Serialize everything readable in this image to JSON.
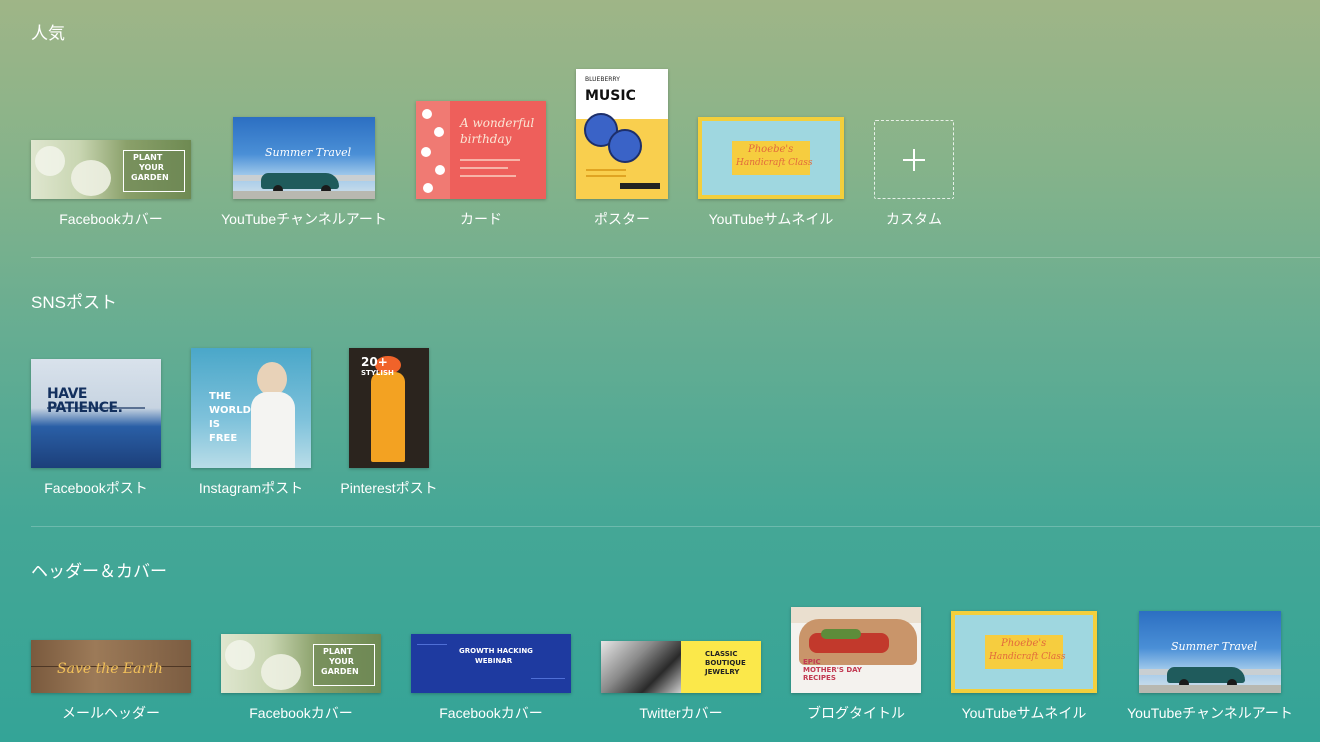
{
  "sections": [
    {
      "title": "人気"
    },
    {
      "title": "SNSポスト"
    },
    {
      "title": "ヘッダー＆カバー"
    }
  ],
  "popular": [
    {
      "label": "Facebookカバー",
      "thumb_text": [
        "PLANT",
        "YOUR",
        "GARDEN"
      ]
    },
    {
      "label": "YouTubeチャンネルアート",
      "thumb_text": [
        "Summer Travel"
      ]
    },
    {
      "label": "カード",
      "thumb_text": [
        "A wonderful",
        "birthday"
      ]
    },
    {
      "label": "ポスター",
      "thumb_text": [
        "BLUEBERRY",
        "MUSIC"
      ]
    },
    {
      "label": "YouTubeサムネイル",
      "thumb_text": [
        "Phoebe's",
        "Handicraft Class"
      ]
    },
    {
      "label": "カスタム"
    }
  ],
  "sns": [
    {
      "label": "Facebookポスト",
      "thumb_text": [
        "HAVE PATIENCE."
      ]
    },
    {
      "label": "Instagramポスト",
      "thumb_text": [
        "THE",
        "WORLD",
        "IS",
        "FREE"
      ]
    },
    {
      "label": "Pinterestポスト",
      "thumb_text": [
        "20+",
        "STYLISH"
      ]
    }
  ],
  "headers": [
    {
      "label": "メールヘッダー",
      "thumb_text": [
        "Save the Earth"
      ]
    },
    {
      "label": "Facebookカバー",
      "thumb_text": [
        "PLANT",
        "YOUR",
        "GARDEN"
      ]
    },
    {
      "label": "Facebookカバー",
      "thumb_text": [
        "GROWTH HACKING",
        "WEBINAR"
      ]
    },
    {
      "label": "Twitterカバー",
      "thumb_text": [
        "CLASSIC",
        "BOUTIQUE",
        "JEWELRY"
      ]
    },
    {
      "label": "ブログタイトル",
      "thumb_text": [
        "EPIC",
        "MOTHER'S DAY",
        "RECIPES"
      ]
    },
    {
      "label": "YouTubeサムネイル",
      "thumb_text": [
        "Phoebe's",
        "Handicraft Class"
      ]
    },
    {
      "label": "YouTubeチャンネルアート",
      "thumb_text": [
        "Summer Travel"
      ]
    }
  ]
}
